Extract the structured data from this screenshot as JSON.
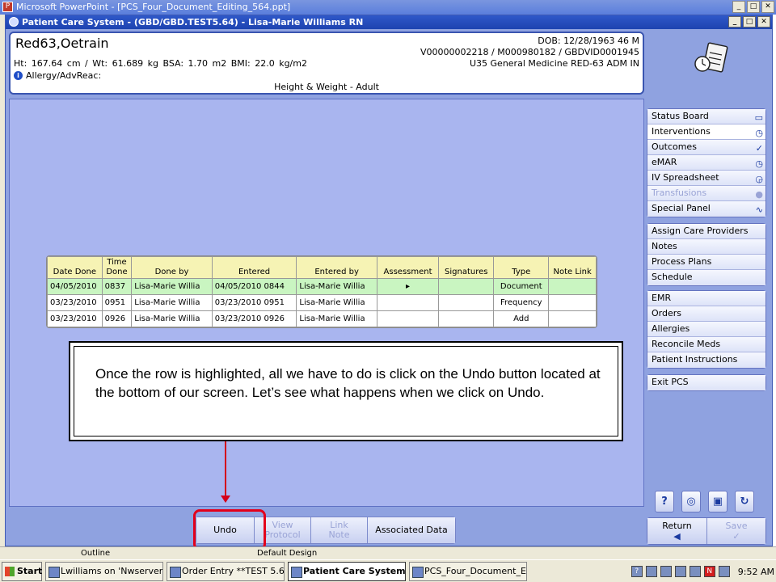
{
  "powerpoint": {
    "title": "Microsoft PowerPoint - [PCS_Four_Document_Editing_564.ppt]",
    "status_outline": "Outline",
    "status_design": "Default Design"
  },
  "pcs_window": {
    "title": "Patient Care System - (GBD/GBD.TEST5.64) - Lisa-Marie Williams RN"
  },
  "patient": {
    "name": "Red63,Oetrain",
    "vitals": "Ht: 167.64 cm / Wt: 61.689 kg    BSA: 1.70 m2   BMI: 22.0 kg/m2",
    "allergy_label": "Allergy/AdvReac:",
    "dob": "DOB: 12/28/1963 46 M",
    "ids": "V00000002218 / M000980182 / GBDVID0001945",
    "location": "U35 General Medicine  RED-63  ADM IN",
    "screen_title": "Height & Weight - Adult"
  },
  "grid": {
    "headers": [
      "Date Done",
      "Time Done",
      "Done by",
      "Entered",
      "Entered by",
      "Assessment",
      "Signatures",
      "Type",
      "Note Link"
    ],
    "rows": [
      {
        "date": "04/05/2010",
        "time": "0837",
        "done_by": "Lisa-Marie Willia",
        "entered": "04/05/2010 0844",
        "entered_by": "Lisa-Marie Willia",
        "assessment": "▸",
        "signatures": "",
        "type": "Document",
        "note_link": ""
      },
      {
        "date": "03/23/2010",
        "time": "0951",
        "done_by": "Lisa-Marie Willia",
        "entered": "03/23/2010 0951",
        "entered_by": "Lisa-Marie Willia",
        "assessment": "",
        "signatures": "",
        "type": "Frequency",
        "note_link": ""
      },
      {
        "date": "03/23/2010",
        "time": "0926",
        "done_by": "Lisa-Marie Willia",
        "entered": "03/23/2010 0926",
        "entered_by": "Lisa-Marie Willia",
        "assessment": "",
        "signatures": "",
        "type": "Add",
        "note_link": ""
      }
    ]
  },
  "callout": {
    "text": "Once the row is highlighted, all we have to do is click on the Undo button located at the bottom of our screen. Let’s see what happens when we click on Undo."
  },
  "toolbar": {
    "undo": "Undo",
    "view_protocol": "View Protocol",
    "link_note": "Link Note",
    "associated_data": "Associated Data"
  },
  "nav": {
    "group1": [
      "Status Board",
      "Interventions",
      "Outcomes",
      "eMAR",
      "IV Spreadsheet",
      "Transfusions",
      "Special Panel"
    ],
    "group2": [
      "Assign Care Providers",
      "Notes",
      "Process Plans",
      "Schedule"
    ],
    "group3": [
      "EMR",
      "Orders",
      "Allergies",
      "Reconcile Meds",
      "Patient Instructions"
    ],
    "group4": [
      "Exit PCS"
    ]
  },
  "bottom_right": {
    "return": "Return",
    "save": "Save"
  },
  "taskbar": {
    "start": "Start",
    "tasks": [
      "Lwilliams on 'Nwserver2\\...",
      "Order Entry **TEST 5.6...",
      "Patient Care System ...",
      "PCS_Four_Document_Ed..."
    ],
    "clock": "9:52 AM"
  },
  "colors": {
    "pcs_background": "#8fa2e0",
    "content_background": "#a9b5ef",
    "selected_row": "#c9f5c1",
    "header_row": "#f6f3b4",
    "highlight_red": "#e3001b"
  }
}
